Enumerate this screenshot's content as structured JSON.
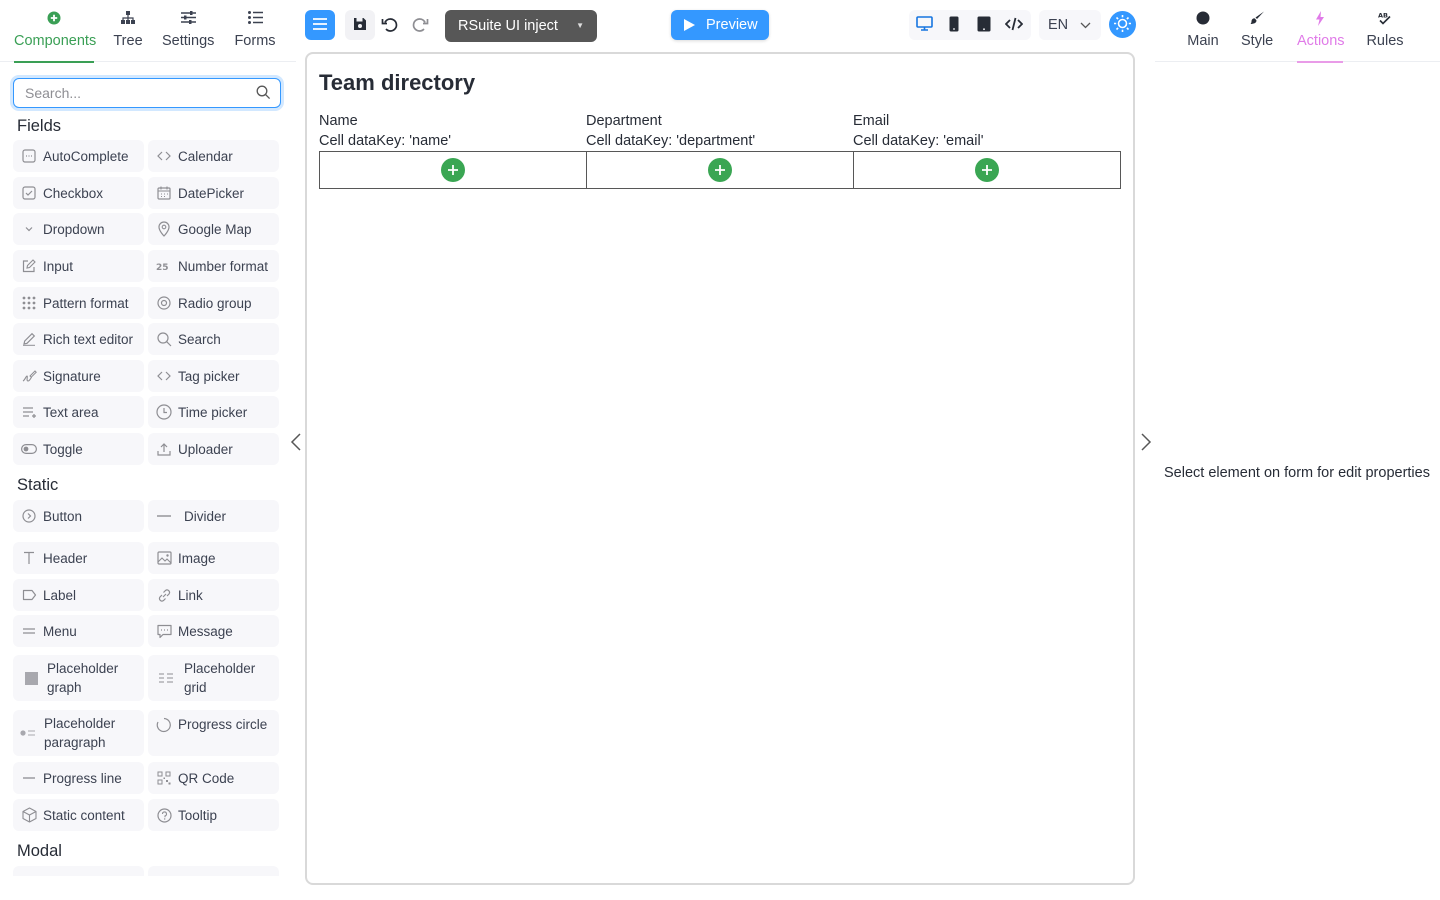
{
  "left_tabs": [
    {
      "label": "Components",
      "icon": "plus-circle-icon",
      "active": true
    },
    {
      "label": "Tree",
      "icon": "tree-icon"
    },
    {
      "label": "Settings",
      "icon": "sliders-icon"
    },
    {
      "label": "Forms",
      "icon": "list-icon"
    }
  ],
  "search": {
    "placeholder": "Search..."
  },
  "sections": {
    "fields": "Fields",
    "static": "Static",
    "modal": "Modal"
  },
  "fields": [
    {
      "label": "AutoComplete",
      "icon": "autocomplete-icon"
    },
    {
      "label": "Calendar",
      "icon": "code-icon"
    },
    {
      "label": "Checkbox",
      "icon": "checkbox-icon"
    },
    {
      "label": "DatePicker",
      "icon": "calendar-icon"
    },
    {
      "label": "Dropdown",
      "icon": "chevron-down-icon"
    },
    {
      "label": "Google Map",
      "icon": "map-pin-icon"
    },
    {
      "label": "Input",
      "icon": "edit-icon"
    },
    {
      "label": "Number format",
      "icon": "number-icon"
    },
    {
      "label": "Pattern format",
      "icon": "grid-dots-icon"
    },
    {
      "label": "Radio group",
      "icon": "radio-icon"
    },
    {
      "label": "Rich text editor",
      "icon": "pen-icon"
    },
    {
      "label": "Search",
      "icon": "search-icon"
    },
    {
      "label": "Signature",
      "icon": "signature-icon"
    },
    {
      "label": "Tag picker",
      "icon": "code-icon"
    },
    {
      "label": "Text area",
      "icon": "text-area-icon"
    },
    {
      "label": "Time picker",
      "icon": "clock-icon"
    },
    {
      "label": "Toggle",
      "icon": "toggle-icon"
    },
    {
      "label": "Uploader",
      "icon": "upload-icon"
    }
  ],
  "static_items": [
    {
      "label": "Button",
      "icon": "button-icon"
    },
    {
      "label": "Divider",
      "icon": "divider-icon"
    },
    {
      "label": "Header",
      "icon": "text-t-icon"
    },
    {
      "label": "Image",
      "icon": "image-icon"
    },
    {
      "label": "Label",
      "icon": "label-icon"
    },
    {
      "label": "Link",
      "icon": "link-icon"
    },
    {
      "label": "Menu",
      "icon": "menu-lines-icon"
    },
    {
      "label": "Message",
      "icon": "message-icon"
    },
    {
      "label": "Placeholder graph",
      "icon": "square-icon"
    },
    {
      "label": "Placeholder grid",
      "icon": "grid-lines-icon"
    },
    {
      "label": "Placeholder paragraph",
      "icon": "paragraph-icon"
    },
    {
      "label": "Progress circle",
      "icon": "progress-circle-icon"
    },
    {
      "label": "Progress line",
      "icon": "line-icon"
    },
    {
      "label": "QR Code",
      "icon": "qr-icon"
    },
    {
      "label": "Static content",
      "icon": "cube-icon"
    },
    {
      "label": "Tooltip",
      "icon": "help-icon"
    }
  ],
  "toolbar": {
    "project": "RSuite UI inject",
    "preview": "Preview",
    "language": "EN"
  },
  "form": {
    "title": "Team directory",
    "columns": [
      {
        "header": "Name",
        "key_text": "Cell dataKey: 'name'"
      },
      {
        "header": "Department",
        "key_text": "Cell dataKey: 'department'"
      },
      {
        "header": "Email",
        "key_text": "Cell dataKey: 'email'"
      }
    ]
  },
  "right_tabs": [
    {
      "label": "Main",
      "icon": "circle-icon"
    },
    {
      "label": "Style",
      "icon": "brush-icon"
    },
    {
      "label": "Actions",
      "icon": "lightning-icon",
      "active": true
    },
    {
      "label": "Rules",
      "icon": "rules-icon"
    }
  ],
  "right_hint": "Select element on form for edit properties",
  "colors": {
    "accent": "#3498ff",
    "green": "#3a9f55",
    "actions_pink": "#e07be8",
    "project_bg": "#575757"
  }
}
